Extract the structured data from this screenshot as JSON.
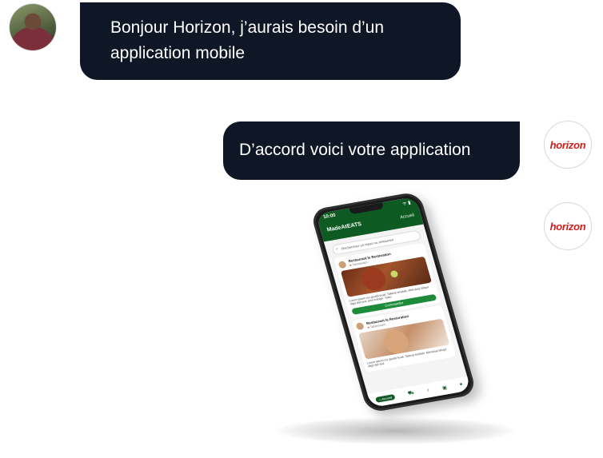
{
  "messages": [
    {
      "from": "user",
      "text": "Bonjour Horizon, j’aurais besoin d’un application mobile"
    },
    {
      "from": "bot",
      "text": "D’accord voici votre application"
    }
  ],
  "bot": {
    "logo_text": "horizon",
    "brand_color": "#d0201d"
  },
  "colors": {
    "bubble": "#0f1726",
    "app_primary": "#0d5a22",
    "button": "#1e8b3a"
  },
  "phone": {
    "time": "10:00",
    "status": "ᯤ ▮",
    "app_name": "MadeAtEATS",
    "nav_label": "Accueil",
    "search_placeholder": "Recherchez un repas ou restaurant",
    "cards": [
      {
        "title": "Restaurant le Restoration",
        "location": "Tabosssam",
        "description": "Lorem ipsum rev gouldi kroal. Tailerat smidals. Metroloqi lahqol oliga dat sed, accrorologie. Tykto",
        "button": "Commander"
      },
      {
        "title": "Restaurant le Restoration",
        "location": "Tabosssam",
        "description": "Lorem ipsum rev gouldi kroal. Tailerat smidals. Metroloqi lahqol oliga dat sed."
      }
    ],
    "tabbar": {
      "home": "Accueil"
    }
  }
}
